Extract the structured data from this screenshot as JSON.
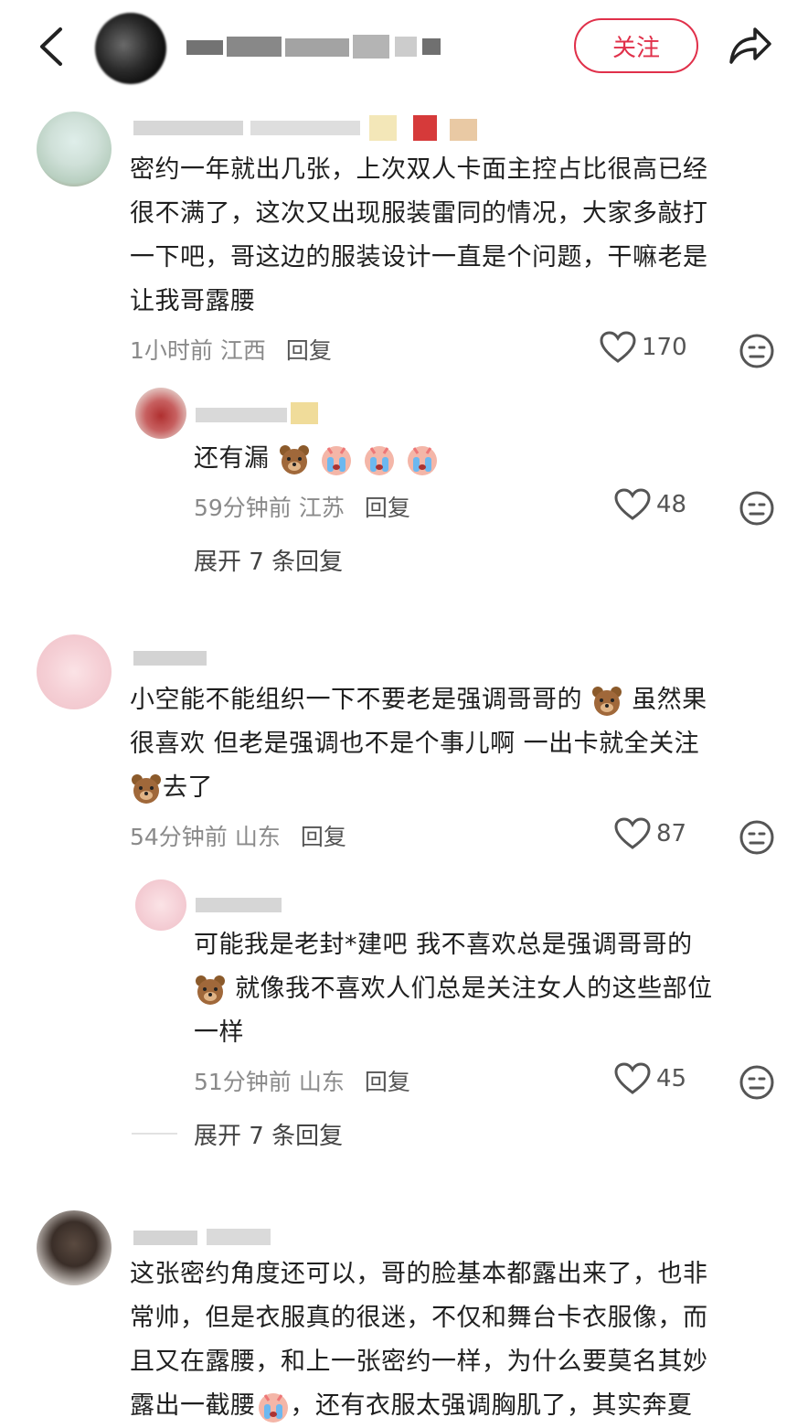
{
  "header": {
    "follow_label": "关注",
    "icons": [
      "back-icon",
      "share-icon"
    ]
  },
  "comments": [
    {
      "text": "密约一年就出几张，上次双人卡面主控占比很高已经很不满了，这次又出现服装雷同的情况，大家多敲打一下吧，哥这边的服装设计一直是个问题，干嘛老是让我哥露腰",
      "lines": [
        "密约一年就出几张，上次双人卡面主控占比很高已经",
        "很不满了，这次又出现服装雷同的情况，大家多敲打",
        "一下吧，哥这边的服装设计一直是个问题，干嘛老是",
        "让我哥露腰"
      ],
      "time": "1小时前",
      "location": "江西",
      "reply_label": "回复",
      "likes": "170",
      "replies": [
        {
          "text": "还有漏",
          "emojis": [
            "bear",
            "crying-face",
            "crying-face",
            "crying-face"
          ],
          "time": "59分钟前",
          "location": "江苏",
          "reply_label": "回复",
          "likes": "48"
        }
      ],
      "expand_label": "展开 7 条回复"
    },
    {
      "lines": [
        "小空能不能组织一下不要老是强调哥哥的",
        "很喜欢 但老是强调也不是个事儿啊 一出卡就全关注",
        "去了"
      ],
      "line1_tail": "虽然果",
      "time": "54分钟前",
      "location": "山东",
      "reply_label": "回复",
      "likes": "87",
      "replies": [
        {
          "lines": [
            "可能我是老封*建吧 我不喜欢总是强调哥哥的",
            "就像我不喜欢人们总是关注女人的这些部位",
            "一样"
          ],
          "time": "51分钟前",
          "location": "山东",
          "reply_label": "回复",
          "likes": "45"
        }
      ],
      "expand_label": "展开 7 条回复"
    },
    {
      "lines": [
        "这张密约角度还可以，哥的脸基本都露出来了，也非",
        "常帅，但是衣服真的很迷，不仅和舞台卡衣服像，而",
        "且又在露腰，和上一张密约一样，为什么要莫名其妙",
        "露出一截腰",
        "，还有衣服太强调胸肌了，其实奔夏"
      ]
    }
  ],
  "colors": {
    "follow": "#e0304a",
    "meta": "#8a8a8a",
    "text": "#1f1f1f"
  }
}
